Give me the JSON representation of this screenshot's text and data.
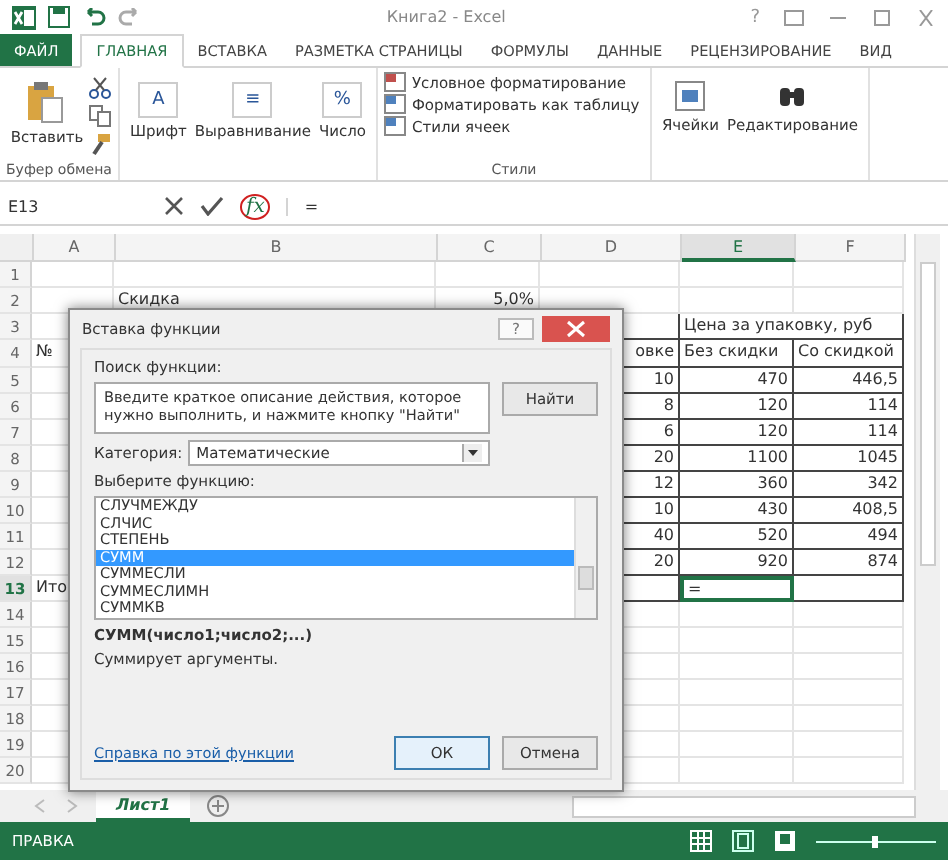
{
  "window": {
    "title": "Книга2 - Excel",
    "help": "?"
  },
  "tabs": [
    {
      "label": "ФАЙЛ",
      "kind": "file",
      "selected": false
    },
    {
      "label": "ГЛАВНАЯ",
      "kind": "tab",
      "selected": true
    },
    {
      "label": "ВСТАВКА",
      "kind": "tab",
      "selected": false
    },
    {
      "label": "РАЗМЕТКА СТРАНИЦЫ",
      "kind": "tab",
      "selected": false
    },
    {
      "label": "ФОРМУЛЫ",
      "kind": "tab",
      "selected": false
    },
    {
      "label": "ДАННЫЕ",
      "kind": "tab",
      "selected": false
    },
    {
      "label": "РЕЦЕНЗИРОВАНИЕ",
      "kind": "tab",
      "selected": false
    },
    {
      "label": "ВИД",
      "kind": "tab",
      "selected": false
    }
  ],
  "ribbon": {
    "clipboard": {
      "paste": "Вставить",
      "label": "Буфер обмена"
    },
    "buttons": [
      {
        "label": "Шрифт",
        "glyph": "A"
      },
      {
        "label": "Выравнивание",
        "glyph": "≡"
      },
      {
        "label": "Число",
        "glyph": "%"
      }
    ],
    "styles": {
      "commands": [
        "Условное форматирование",
        "Форматировать как таблицу",
        "Стили ячеек"
      ],
      "label": "Стили"
    },
    "buttons2": [
      {
        "label": "Ячейки"
      },
      {
        "label": "Редактирование"
      }
    ]
  },
  "formula_bar": {
    "name_box": "E13",
    "fx": "fx",
    "value": "="
  },
  "sheet": {
    "columns": [
      {
        "label": "A",
        "selected": false
      },
      {
        "label": "B",
        "selected": false
      },
      {
        "label": "C",
        "selected": false
      },
      {
        "label": "D",
        "selected": false
      },
      {
        "label": "E",
        "selected": true
      },
      {
        "label": "F",
        "selected": false
      }
    ],
    "rows": [
      {
        "number": "1",
        "selected": false,
        "bordered": false,
        "cells": [
          null,
          null,
          null,
          null,
          null,
          null
        ]
      },
      {
        "number": "2",
        "selected": false,
        "bordered": false,
        "cells": [
          null,
          {
            "text": "Скидка",
            "kind": "text"
          },
          {
            "text": "5,0%",
            "kind": "number"
          },
          null,
          null,
          null
        ]
      },
      {
        "number": "3",
        "selected": false,
        "bordered": true,
        "cells": [
          null,
          null,
          null,
          null,
          {
            "text": "Цена за упаковку, руб",
            "kind": "merged"
          },
          null
        ]
      },
      {
        "number": "4",
        "selected": false,
        "bordered": true,
        "cells": [
          {
            "text": "№",
            "kind": "text"
          },
          null,
          null,
          {
            "text": "овке",
            "kind": "number"
          },
          {
            "text": "Без скидки",
            "kind": "text"
          },
          {
            "text": "Со скидкой",
            "kind": "text"
          }
        ]
      },
      {
        "number": "5",
        "selected": false,
        "bordered": true,
        "cells": [
          null,
          null,
          null,
          {
            "text": "10",
            "kind": "number"
          },
          {
            "text": "470",
            "kind": "number"
          },
          {
            "text": "446,5",
            "kind": "number"
          }
        ]
      },
      {
        "number": "6",
        "selected": false,
        "bordered": true,
        "cells": [
          null,
          null,
          null,
          {
            "text": "8",
            "kind": "number"
          },
          {
            "text": "120",
            "kind": "number"
          },
          {
            "text": "114",
            "kind": "number"
          }
        ]
      },
      {
        "number": "7",
        "selected": false,
        "bordered": true,
        "cells": [
          null,
          null,
          null,
          {
            "text": "6",
            "kind": "number"
          },
          {
            "text": "120",
            "kind": "number"
          },
          {
            "text": "114",
            "kind": "number"
          }
        ]
      },
      {
        "number": "8",
        "selected": false,
        "bordered": true,
        "cells": [
          null,
          null,
          null,
          {
            "text": "20",
            "kind": "number"
          },
          {
            "text": "1100",
            "kind": "number"
          },
          {
            "text": "1045",
            "kind": "number"
          }
        ]
      },
      {
        "number": "9",
        "selected": false,
        "bordered": true,
        "cells": [
          null,
          null,
          null,
          {
            "text": "12",
            "kind": "number"
          },
          {
            "text": "360",
            "kind": "number"
          },
          {
            "text": "342",
            "kind": "number"
          }
        ]
      },
      {
        "number": "10",
        "selected": false,
        "bordered": true,
        "cells": [
          null,
          null,
          null,
          {
            "text": "10",
            "kind": "number"
          },
          {
            "text": "430",
            "kind": "number"
          },
          {
            "text": "408,5",
            "kind": "number"
          }
        ]
      },
      {
        "number": "11",
        "selected": false,
        "bordered": true,
        "cells": [
          null,
          null,
          null,
          {
            "text": "40",
            "kind": "number"
          },
          {
            "text": "520",
            "kind": "number"
          },
          {
            "text": "494",
            "kind": "number"
          }
        ]
      },
      {
        "number": "12",
        "selected": false,
        "bordered": true,
        "cells": [
          null,
          null,
          null,
          {
            "text": "20",
            "kind": "number"
          },
          {
            "text": "920",
            "kind": "number"
          },
          {
            "text": "874",
            "kind": "number"
          }
        ]
      },
      {
        "number": "13",
        "selected": true,
        "bordered": true,
        "cells": [
          {
            "text": "Ито",
            "kind": "text"
          },
          null,
          null,
          null,
          {
            "text": "=",
            "kind": "active"
          },
          null
        ]
      },
      {
        "number": "14",
        "selected": false,
        "bordered": false,
        "cells": [
          null,
          null,
          null,
          null,
          null,
          null
        ]
      },
      {
        "number": "15",
        "selected": false,
        "bordered": false,
        "cells": [
          null,
          null,
          null,
          null,
          null,
          null
        ]
      },
      {
        "number": "16",
        "selected": false,
        "bordered": false,
        "cells": [
          null,
          null,
          null,
          null,
          null,
          null
        ]
      },
      {
        "number": "17",
        "selected": false,
        "bordered": false,
        "cells": [
          null,
          null,
          null,
          null,
          null,
          null
        ]
      },
      {
        "number": "18",
        "selected": false,
        "bordered": false,
        "cells": [
          null,
          null,
          null,
          null,
          null,
          null
        ]
      },
      {
        "number": "19",
        "selected": false,
        "bordered": false,
        "cells": [
          null,
          null,
          null,
          null,
          null,
          null
        ]
      },
      {
        "number": "20",
        "selected": false,
        "bordered": false,
        "cells": [
          null,
          null,
          null,
          null,
          null,
          null
        ]
      }
    ]
  },
  "dialog": {
    "title": "Вставка функции",
    "help": "?",
    "search_label": "Поиск функции:",
    "search_value": "Введите краткое описание действия, которое нужно выполнить, и нажмите кнопку \"Найти\"",
    "find_button": "Найти",
    "category_label": "Категория:",
    "category_value": "Математические",
    "list_label": "Выберите функцию:",
    "functions": [
      {
        "name": "СЛУЧМЕЖДУ",
        "selected": false
      },
      {
        "name": "СЛЧИС",
        "selected": false
      },
      {
        "name": "СТЕПЕНЬ",
        "selected": false
      },
      {
        "name": "СУММ",
        "selected": true
      },
      {
        "name": "СУММЕСЛИ",
        "selected": false
      },
      {
        "name": "СУММЕСЛИМН",
        "selected": false
      },
      {
        "name": "СУММКВ",
        "selected": false
      }
    ],
    "signature": "СУММ(число1;число2;...)",
    "description": "Суммирует аргументы.",
    "help_link": "Справка по этой функции",
    "ok": "ОК",
    "cancel": "Отмена"
  },
  "sheet_tabs": [
    {
      "label": "Лист1",
      "selected": true
    }
  ],
  "status_bar": {
    "mode": "ПРАВКА"
  }
}
